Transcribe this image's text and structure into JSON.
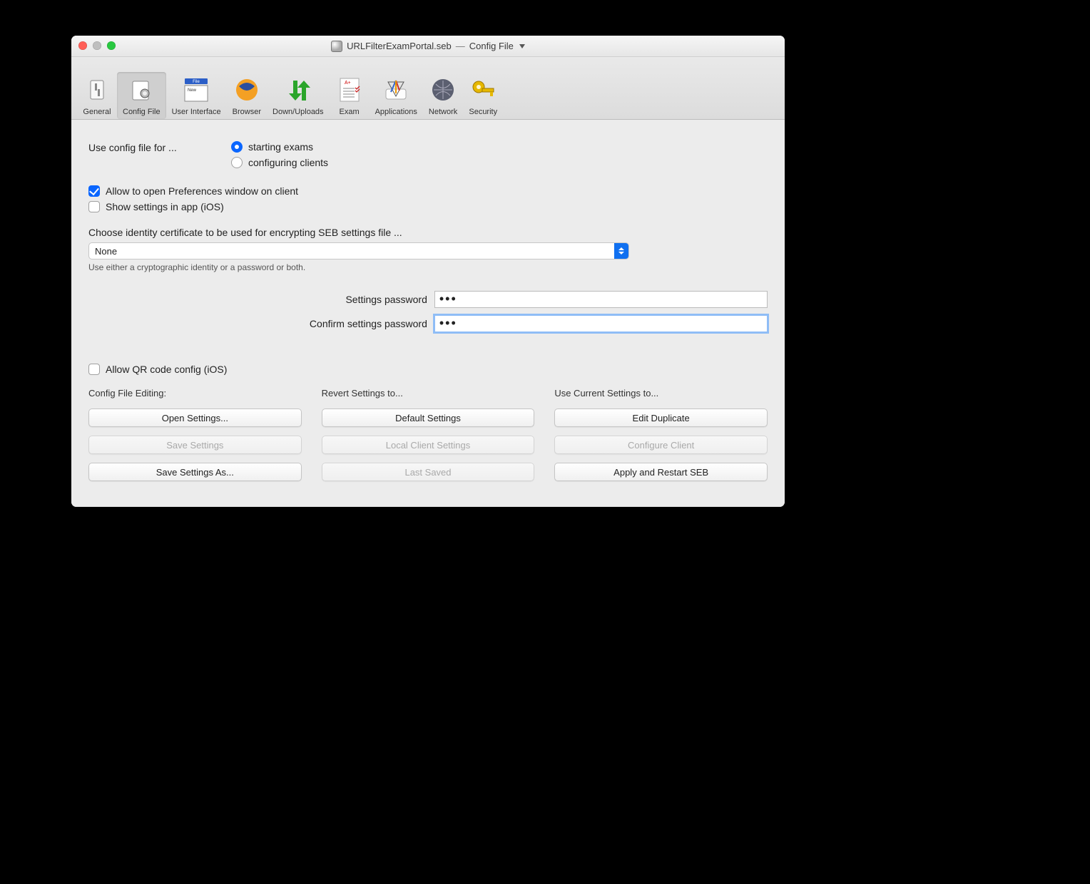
{
  "title": {
    "docname": "URLFilterExamPortal.seb",
    "section": "Config File"
  },
  "toolbar": {
    "items": [
      {
        "label": "General"
      },
      {
        "label": "Config File"
      },
      {
        "label": "User Interface"
      },
      {
        "label": "Browser"
      },
      {
        "label": "Down/Uploads"
      },
      {
        "label": "Exam"
      },
      {
        "label": "Applications"
      },
      {
        "label": "Network"
      },
      {
        "label": "Security"
      }
    ],
    "selected": "Config File"
  },
  "config": {
    "useConfigLabel": "Use config file for ...",
    "radioOptions": {
      "starting": "starting exams",
      "configuring": "configuring clients"
    },
    "allowPrefs": "Allow to open Preferences window on client",
    "showIOS": "Show settings in app (iOS)",
    "certLabel": "Choose identity certificate to be used for encrypting SEB settings file ...",
    "certValue": "None",
    "certHint": "Use either a cryptographic identity or a password or both.",
    "settingsPwLabel": "Settings password",
    "confirmPwLabel": "Confirm settings password",
    "settingsPwValue": "•••",
    "confirmPwValue": "•••",
    "allowQR": "Allow QR code config (iOS)"
  },
  "buttons": {
    "colHeaders": {
      "editing": "Config File Editing:",
      "revert": "Revert Settings to...",
      "use": "Use Current Settings to..."
    },
    "editing": {
      "open": "Open Settings...",
      "save": "Save Settings",
      "saveAs": "Save Settings As..."
    },
    "revert": {
      "default": "Default Settings",
      "local": "Local Client Settings",
      "last": "Last Saved"
    },
    "use": {
      "editDup": "Edit Duplicate",
      "configClient": "Configure Client",
      "apply": "Apply and Restart SEB"
    }
  }
}
